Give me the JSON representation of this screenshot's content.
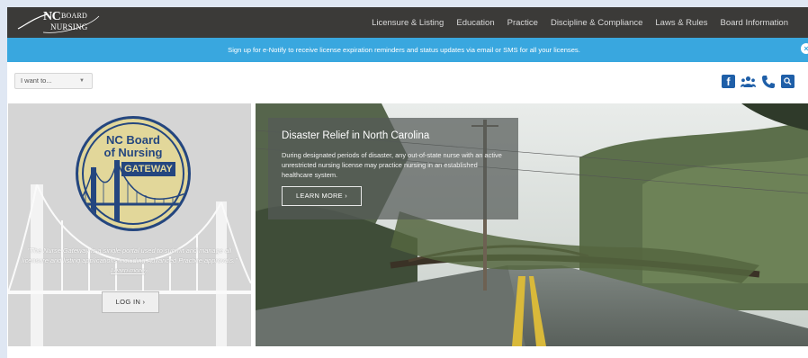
{
  "header": {
    "logo": {
      "line1": "NC",
      "line2": "BOARD",
      "line3": "NURSING"
    },
    "nav": [
      {
        "label": "Licensure & Listing"
      },
      {
        "label": "Education"
      },
      {
        "label": "Practice"
      },
      {
        "label": "Discipline & Compliance"
      },
      {
        "label": "Laws & Rules"
      },
      {
        "label": "Board Information"
      }
    ]
  },
  "banner": {
    "message": "Sign up for e-Notify to receive license expiration reminders and status updates via email or SMS for all your licenses.",
    "close_glyph": "×"
  },
  "toolbar": {
    "i_want_to": {
      "selected": "I want to...",
      "caret": "▼"
    },
    "social_icons": [
      "facebook-icon",
      "people-icon",
      "phone-icon",
      "search-icon"
    ]
  },
  "gateway": {
    "badge": {
      "line1": "NC Board",
      "line2": "of Nursing",
      "line3": "GATEWAY"
    },
    "quote": "\"The Nurse Gateway is a single portal used to submit and manage all licensure and listing applications including Advanced Practice approvals.\"",
    "learn_more": "Learn more",
    "learn_more_arrow": "»",
    "login_label": "LOG IN ›"
  },
  "hero": {
    "title": "Disaster Relief in North Carolina",
    "body": "During designated periods of disaster, any out-of-state nurse with an active unrestricted nursing license may practice nursing in an established healthcare system.",
    "button_label": "LEARN MORE ›"
  },
  "colors": {
    "nav_bg": "#3b3a38",
    "banner_bg": "#39a7df",
    "brand_blue": "#1f5fa8",
    "badge_gold": "#e2d79a",
    "badge_navy": "#24467f"
  }
}
